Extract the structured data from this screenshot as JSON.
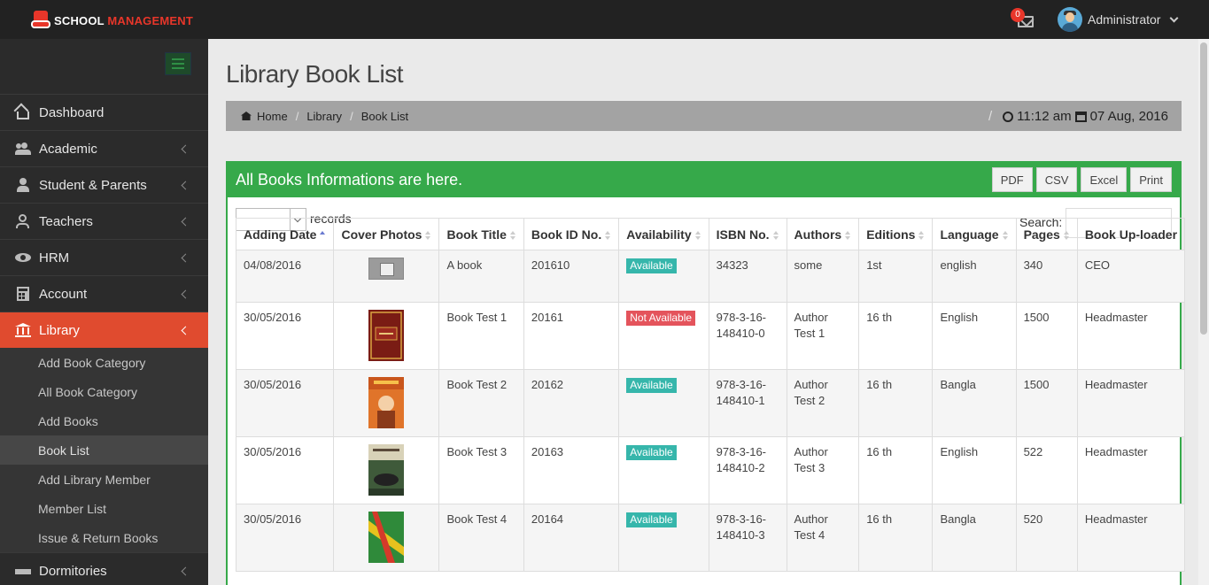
{
  "brand": {
    "name_part1": "SCHOOL",
    "name_part2": "MANAGEMENT"
  },
  "header": {
    "notification_count": "0",
    "user_name": "Administrator"
  },
  "sidebar": {
    "items": [
      {
        "label": "Dashboard",
        "icon": "home-icon"
      },
      {
        "label": "Academic",
        "icon": "users-icon"
      },
      {
        "label": "Student & Parents",
        "icon": "user-icon"
      },
      {
        "label": "Teachers",
        "icon": "teacher-icon"
      },
      {
        "label": "HRM",
        "icon": "eye-icon"
      },
      {
        "label": "Account",
        "icon": "calculator-icon"
      },
      {
        "label": "Library",
        "icon": "bank-icon"
      }
    ],
    "library_sub": [
      {
        "label": "Add Book Category"
      },
      {
        "label": "All Book Category"
      },
      {
        "label": "Add Books"
      },
      {
        "label": "Book List"
      },
      {
        "label": "Add Library Member"
      },
      {
        "label": "Member List"
      },
      {
        "label": "Issue & Return Books"
      }
    ],
    "next_item": {
      "label": "Dormitories"
    }
  },
  "page": {
    "title": "Library Book List",
    "breadcrumb": [
      "Home",
      "Library",
      "Book List"
    ],
    "time": "11:12 am",
    "date": "07 Aug, 2016"
  },
  "panel": {
    "heading": "All Books Informations are here.",
    "exports": [
      "PDF",
      "CSV",
      "Excel",
      "Print"
    ],
    "records_label": "records",
    "search_label": "Search:"
  },
  "table": {
    "columns": [
      "Adding Date",
      "Cover Photos",
      "Book Title",
      "Book ID No.",
      "Availability",
      "ISBN No.",
      "Authors",
      "Editions",
      "Language",
      "Pages",
      "Book Up-loader"
    ],
    "rows": [
      {
        "date": "04/08/2016",
        "title": "A book",
        "id": "201610",
        "availability": "Available",
        "isbn": "34323",
        "authors": "some",
        "edition": "1st",
        "language": "english",
        "pages": "340",
        "uploader": "CEO"
      },
      {
        "date": "30/05/2016",
        "title": "Book Test 1",
        "id": "20161",
        "availability": "Not Available",
        "isbn": "978-3-16-148410-0",
        "authors": "Author Test 1",
        "edition": "16 th",
        "language": "English",
        "pages": "1500",
        "uploader": "Headmaster"
      },
      {
        "date": "30/05/2016",
        "title": "Book Test 2",
        "id": "20162",
        "availability": "Available",
        "isbn": "978-3-16-148410-1",
        "authors": "Author Test 2",
        "edition": "16 th",
        "language": "Bangla",
        "pages": "1500",
        "uploader": "Headmaster"
      },
      {
        "date": "30/05/2016",
        "title": "Book Test 3",
        "id": "20163",
        "availability": "Available",
        "isbn": "978-3-16-148410-2",
        "authors": "Author Test 3",
        "edition": "16 th",
        "language": "English",
        "pages": "522",
        "uploader": "Headmaster"
      },
      {
        "date": "30/05/2016",
        "title": "Book Test 4",
        "id": "20164",
        "availability": "Available",
        "isbn": "978-3-16-148410-3",
        "authors": "Author Test 4",
        "edition": "16 th",
        "language": "Bangla",
        "pages": "520",
        "uploader": "Headmaster"
      }
    ]
  },
  "colors": {
    "topbar": "#222222",
    "accent_red": "#e04b2f",
    "panel_green": "#36a94a",
    "available": "#36b6ab",
    "not_available": "#e4545c"
  }
}
